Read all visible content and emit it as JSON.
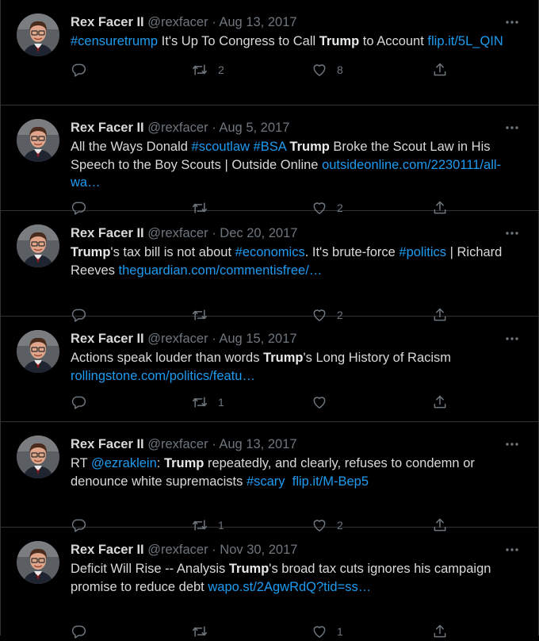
{
  "author": {
    "name": "Rex Facer II",
    "handle": "@rexfacer"
  },
  "colors": {
    "background": "#000000",
    "link": "#1d9bf0",
    "muted": "#6e767d",
    "text": "#d9d9d9",
    "divider": "#2f3336"
  },
  "icons": {
    "reply": "reply-icon",
    "retweet": "retweet-icon",
    "like": "heart-icon",
    "share": "share-icon",
    "more": "more-icon"
  },
  "tweets": [
    {
      "date": "Aug 13, 2017",
      "segments": [
        {
          "t": "#censuretrump",
          "s": "l"
        },
        {
          "t": " It's Up To Congress to Call ",
          "s": "n"
        },
        {
          "t": "Trump",
          "s": "b"
        },
        {
          "t": " to Account ",
          "s": "n"
        },
        {
          "t": "flip.it/5L_QIN",
          "s": "l"
        }
      ],
      "replies": "",
      "retweets": "2",
      "likes": "8"
    },
    {
      "date": "Aug 5, 2017",
      "segments": [
        {
          "t": "All the Ways Donald ",
          "s": "n"
        },
        {
          "t": "#scoutlaw",
          "s": "l"
        },
        {
          "t": " ",
          "s": "n"
        },
        {
          "t": "#BSA",
          "s": "l"
        },
        {
          "t": " ",
          "s": "n"
        },
        {
          "t": "Trump",
          "s": "b"
        },
        {
          "t": " Broke the Scout Law in His Speech to the Boy Scouts | Outside Online ",
          "s": "n"
        },
        {
          "t": "outsideonline.com/2230111/all-wa…",
          "s": "l"
        }
      ],
      "replies": "",
      "retweets": "",
      "likes": "2"
    },
    {
      "date": "Dec 20, 2017",
      "segments": [
        {
          "t": "Trump",
          "s": "b"
        },
        {
          "t": "'s tax bill is not about ",
          "s": "n"
        },
        {
          "t": "#economics",
          "s": "l"
        },
        {
          "t": ". It's brute-force ",
          "s": "n"
        },
        {
          "t": "#politics",
          "s": "l"
        },
        {
          "t": " | Richard Reeves ",
          "s": "n"
        },
        {
          "t": "theguardian.com/commentisfree/…",
          "s": "l"
        }
      ],
      "replies": "",
      "retweets": "",
      "likes": "2"
    },
    {
      "date": "Aug 15, 2017",
      "segments": [
        {
          "t": "Actions speak louder than words ",
          "s": "n"
        },
        {
          "t": "Trump",
          "s": "b"
        },
        {
          "t": "'s Long History of Racism ",
          "s": "n"
        },
        {
          "t": "rollingstone.com/politics/featu…",
          "s": "l"
        }
      ],
      "replies": "",
      "retweets": "1",
      "likes": ""
    },
    {
      "date": "Aug 13, 2017",
      "segments": [
        {
          "t": "RT ",
          "s": "n"
        },
        {
          "t": "@ezraklein",
          "s": "l"
        },
        {
          "t": ": ",
          "s": "n"
        },
        {
          "t": "Trump",
          "s": "b"
        },
        {
          "t": " repeatedly, and clearly, refuses to condemn or denounce white supremacists ",
          "s": "n"
        },
        {
          "t": "#scary",
          "s": "l"
        },
        {
          "t": "  ",
          "s": "n"
        },
        {
          "t": "flip.it/M-Bep5",
          "s": "l"
        }
      ],
      "replies": "",
      "retweets": "1",
      "likes": "2"
    },
    {
      "date": "Nov 30, 2017",
      "segments": [
        {
          "t": "Deficit Will Rise -- Analysis ",
          "s": "n"
        },
        {
          "t": "Trump",
          "s": "b"
        },
        {
          "t": "'s broad tax cuts ignores his campaign promise to reduce debt ",
          "s": "n"
        },
        {
          "t": "wapo.st/2AgwRdQ?tid=ss…",
          "s": "l"
        }
      ],
      "replies": "",
      "retweets": "",
      "likes": "1"
    }
  ]
}
